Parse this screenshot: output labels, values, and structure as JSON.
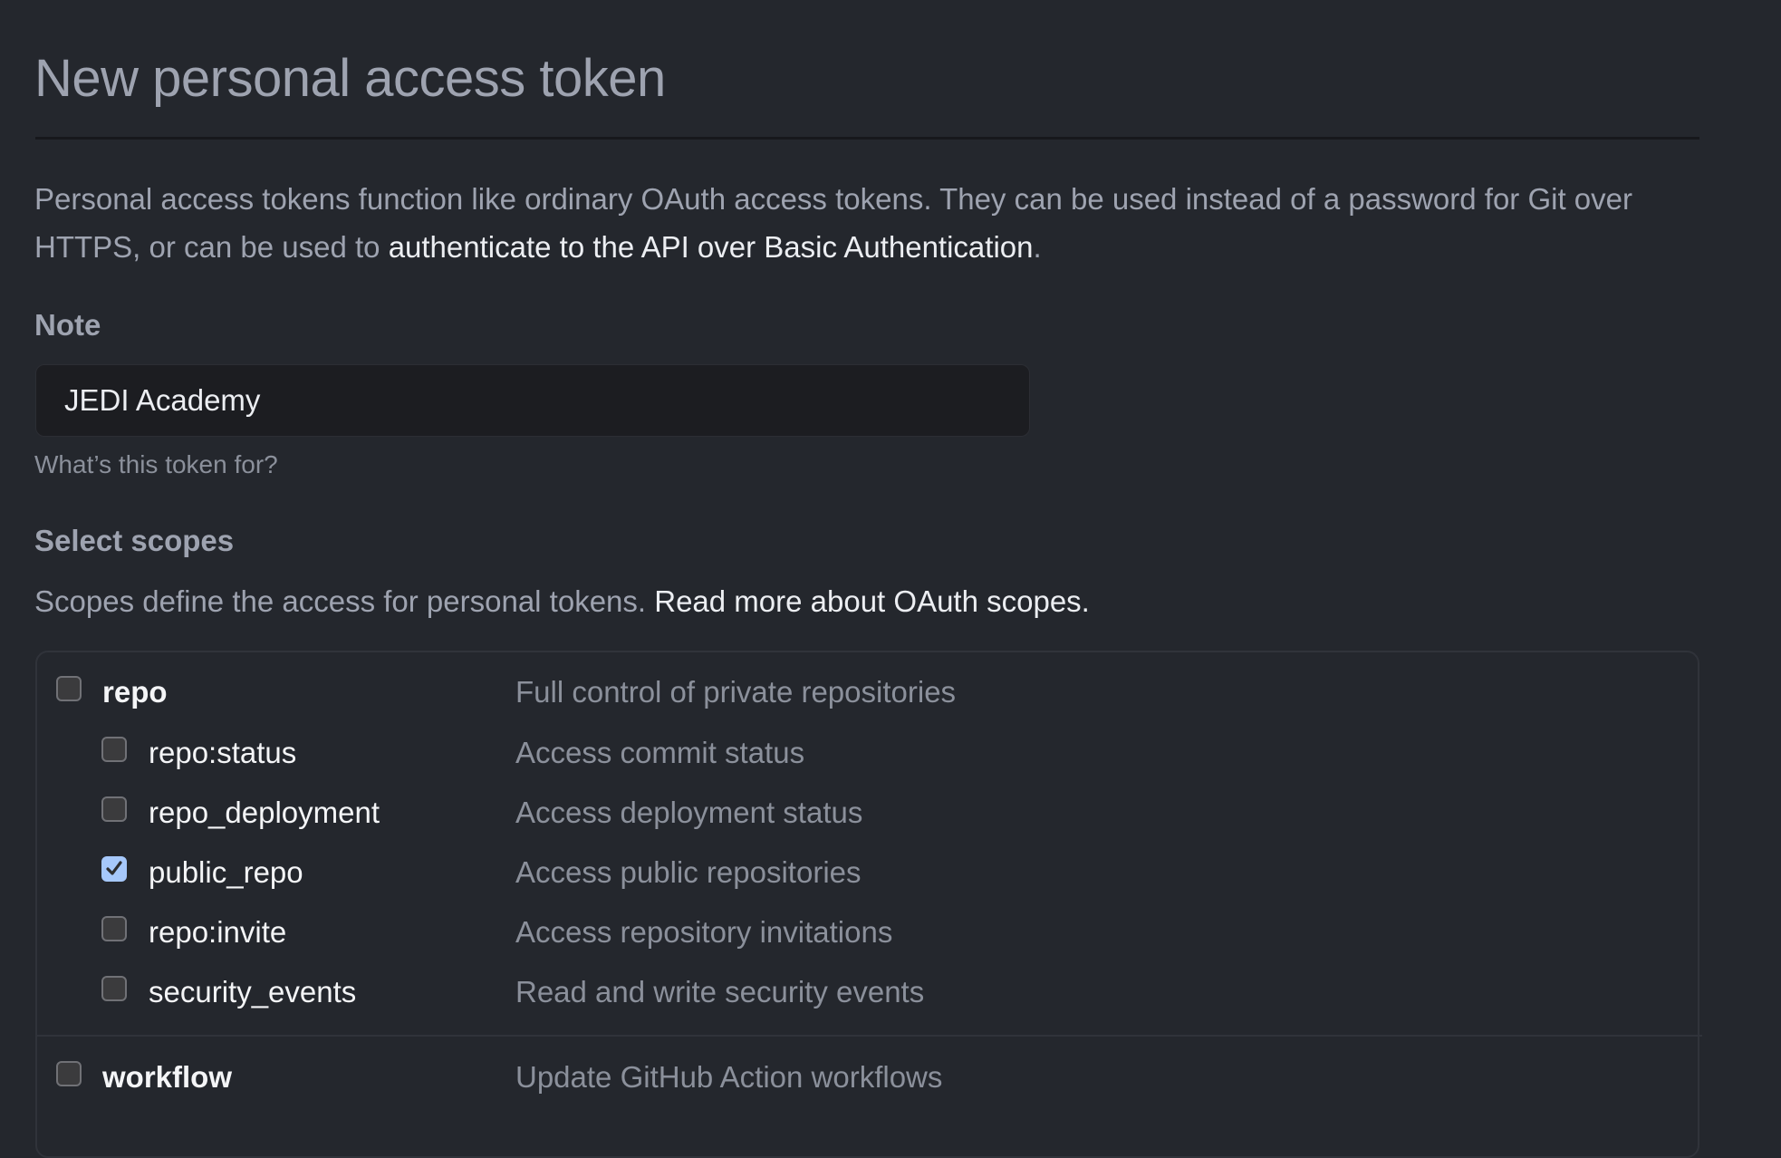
{
  "page": {
    "title": "New personal access token"
  },
  "intro": {
    "text_before": "Personal access tokens function like ordinary OAuth access tokens. They can be used instead of a password for Git over HTTPS, or can be used to ",
    "link": "authenticate to the API over Basic Authentication",
    "text_after": "."
  },
  "note": {
    "label": "Note",
    "value": "JEDI Academy",
    "helper": "What’s this token for?"
  },
  "scopes": {
    "label": "Select scopes",
    "description": "Scopes define the access for personal tokens. ",
    "link": "Read more about OAuth scopes.",
    "items": [
      {
        "name": "repo",
        "description": "Full control of private repositories",
        "checked": false,
        "level": 0
      },
      {
        "name": "repo:status",
        "description": "Access commit status",
        "checked": false,
        "level": 1
      },
      {
        "name": "repo_deployment",
        "description": "Access deployment status",
        "checked": false,
        "level": 1
      },
      {
        "name": "public_repo",
        "description": "Access public repositories",
        "checked": true,
        "level": 1
      },
      {
        "name": "repo:invite",
        "description": "Access repository invitations",
        "checked": false,
        "level": 1
      },
      {
        "name": "security_events",
        "description": "Read and write security events",
        "checked": false,
        "level": 1
      },
      {
        "name": "workflow",
        "description": "Update GitHub Action workflows",
        "checked": false,
        "level": 0
      }
    ]
  },
  "colors": {
    "background": "#24272d",
    "muted_text": "#9ea3b0",
    "bright_text": "#eceef2",
    "checkbox_checked": "#a6c8fb"
  }
}
